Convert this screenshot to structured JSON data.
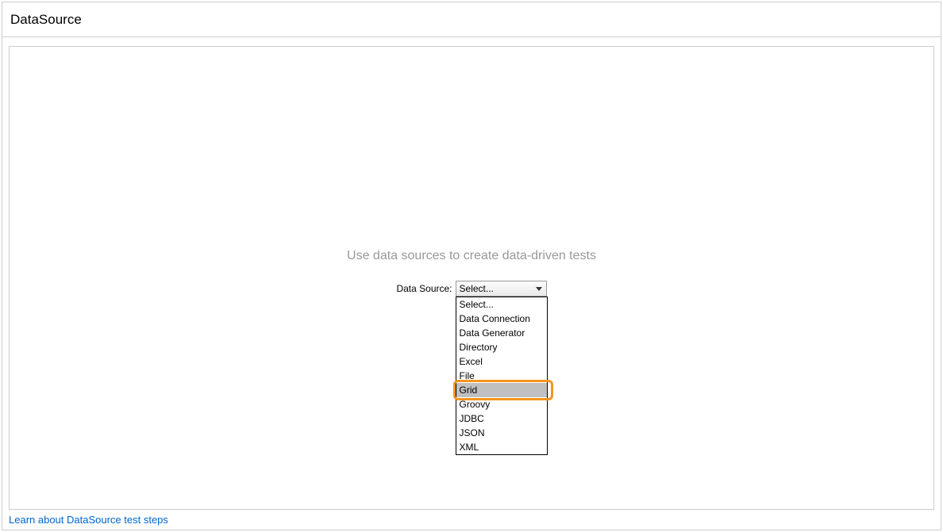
{
  "header": {
    "title": "DataSource"
  },
  "main": {
    "prompt": "Use data sources to create data-driven tests",
    "label": "Data Source:",
    "selected": "Select...",
    "options": [
      "Select...",
      "Data Connection",
      "Data Generator",
      "Directory",
      "Excel",
      "File",
      "Grid",
      "Groovy",
      "JDBC",
      "JSON",
      "XML"
    ],
    "highlighted_option": "Grid"
  },
  "footer": {
    "link": "Learn about DataSource test steps"
  }
}
